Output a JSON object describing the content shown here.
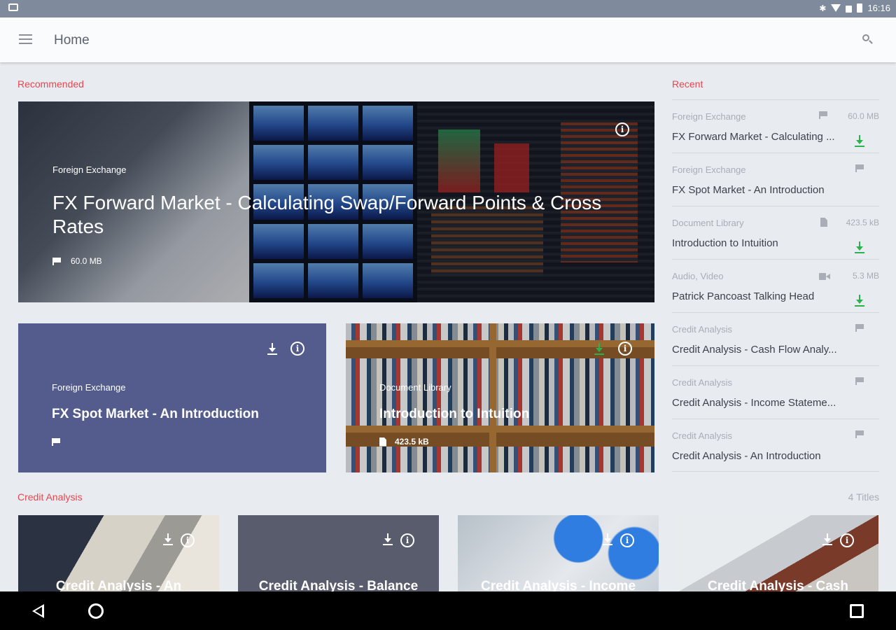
{
  "status_bar": {
    "time": "16:16"
  },
  "toolbar": {
    "title": "Home"
  },
  "recommended": {
    "section_label": "Recommended",
    "hero": {
      "category": "Foreign Exchange",
      "title": "FX Forward Market - Calculating Swap/Forward Points & Cross Rates",
      "size": "60.0 MB"
    },
    "cards": [
      {
        "category": "Foreign Exchange",
        "title": "FX Spot Market - An Introduction"
      },
      {
        "category": "Document Library",
        "title": "Introduction to Intuition",
        "size": "423.5 kB"
      }
    ]
  },
  "recent": {
    "section_label": "Recent",
    "items": [
      {
        "category": "Foreign Exchange",
        "icon": "flag-icon",
        "size": "60.0 MB",
        "title": "FX Forward Market - Calculating ...",
        "downloaded": true
      },
      {
        "category": "Foreign Exchange",
        "icon": "flag-icon",
        "size": "",
        "title": "FX Spot Market - An Introduction",
        "downloaded": false
      },
      {
        "category": "Document Library",
        "icon": "document-icon",
        "size": "423.5 kB",
        "title": "Introduction to Intuition",
        "downloaded": true
      },
      {
        "category": "Audio, Video",
        "icon": "video-icon",
        "size": "5.3 MB",
        "title": "Patrick Pancoast Talking Head",
        "downloaded": true
      },
      {
        "category": "Credit Analysis",
        "icon": "flag-icon",
        "size": "",
        "title": "Credit Analysis - Cash Flow Analy...",
        "downloaded": false
      },
      {
        "category": "Credit Analysis",
        "icon": "flag-icon",
        "size": "",
        "title": "Credit Analysis - Income Stateme...",
        "downloaded": false
      },
      {
        "category": "Credit Analysis",
        "icon": "flag-icon",
        "size": "",
        "title": "Credit Analysis - An Introduction",
        "downloaded": false
      }
    ]
  },
  "credit_analysis": {
    "section_label": "Credit Analysis",
    "count": "4 Titles",
    "cards": [
      {
        "title": "Credit Analysis - An"
      },
      {
        "title": "Credit Analysis - Balance"
      },
      {
        "title": "Credit Analysis - Income"
      },
      {
        "title": "Credit Analysis - Cash"
      }
    ]
  },
  "colors": {
    "accent": "#e4474f",
    "card_blue": "#535c8d",
    "download_green": "#2bb24c",
    "toolbar_bg": "#fafbfc",
    "page_bg": "#e8ebf0"
  }
}
